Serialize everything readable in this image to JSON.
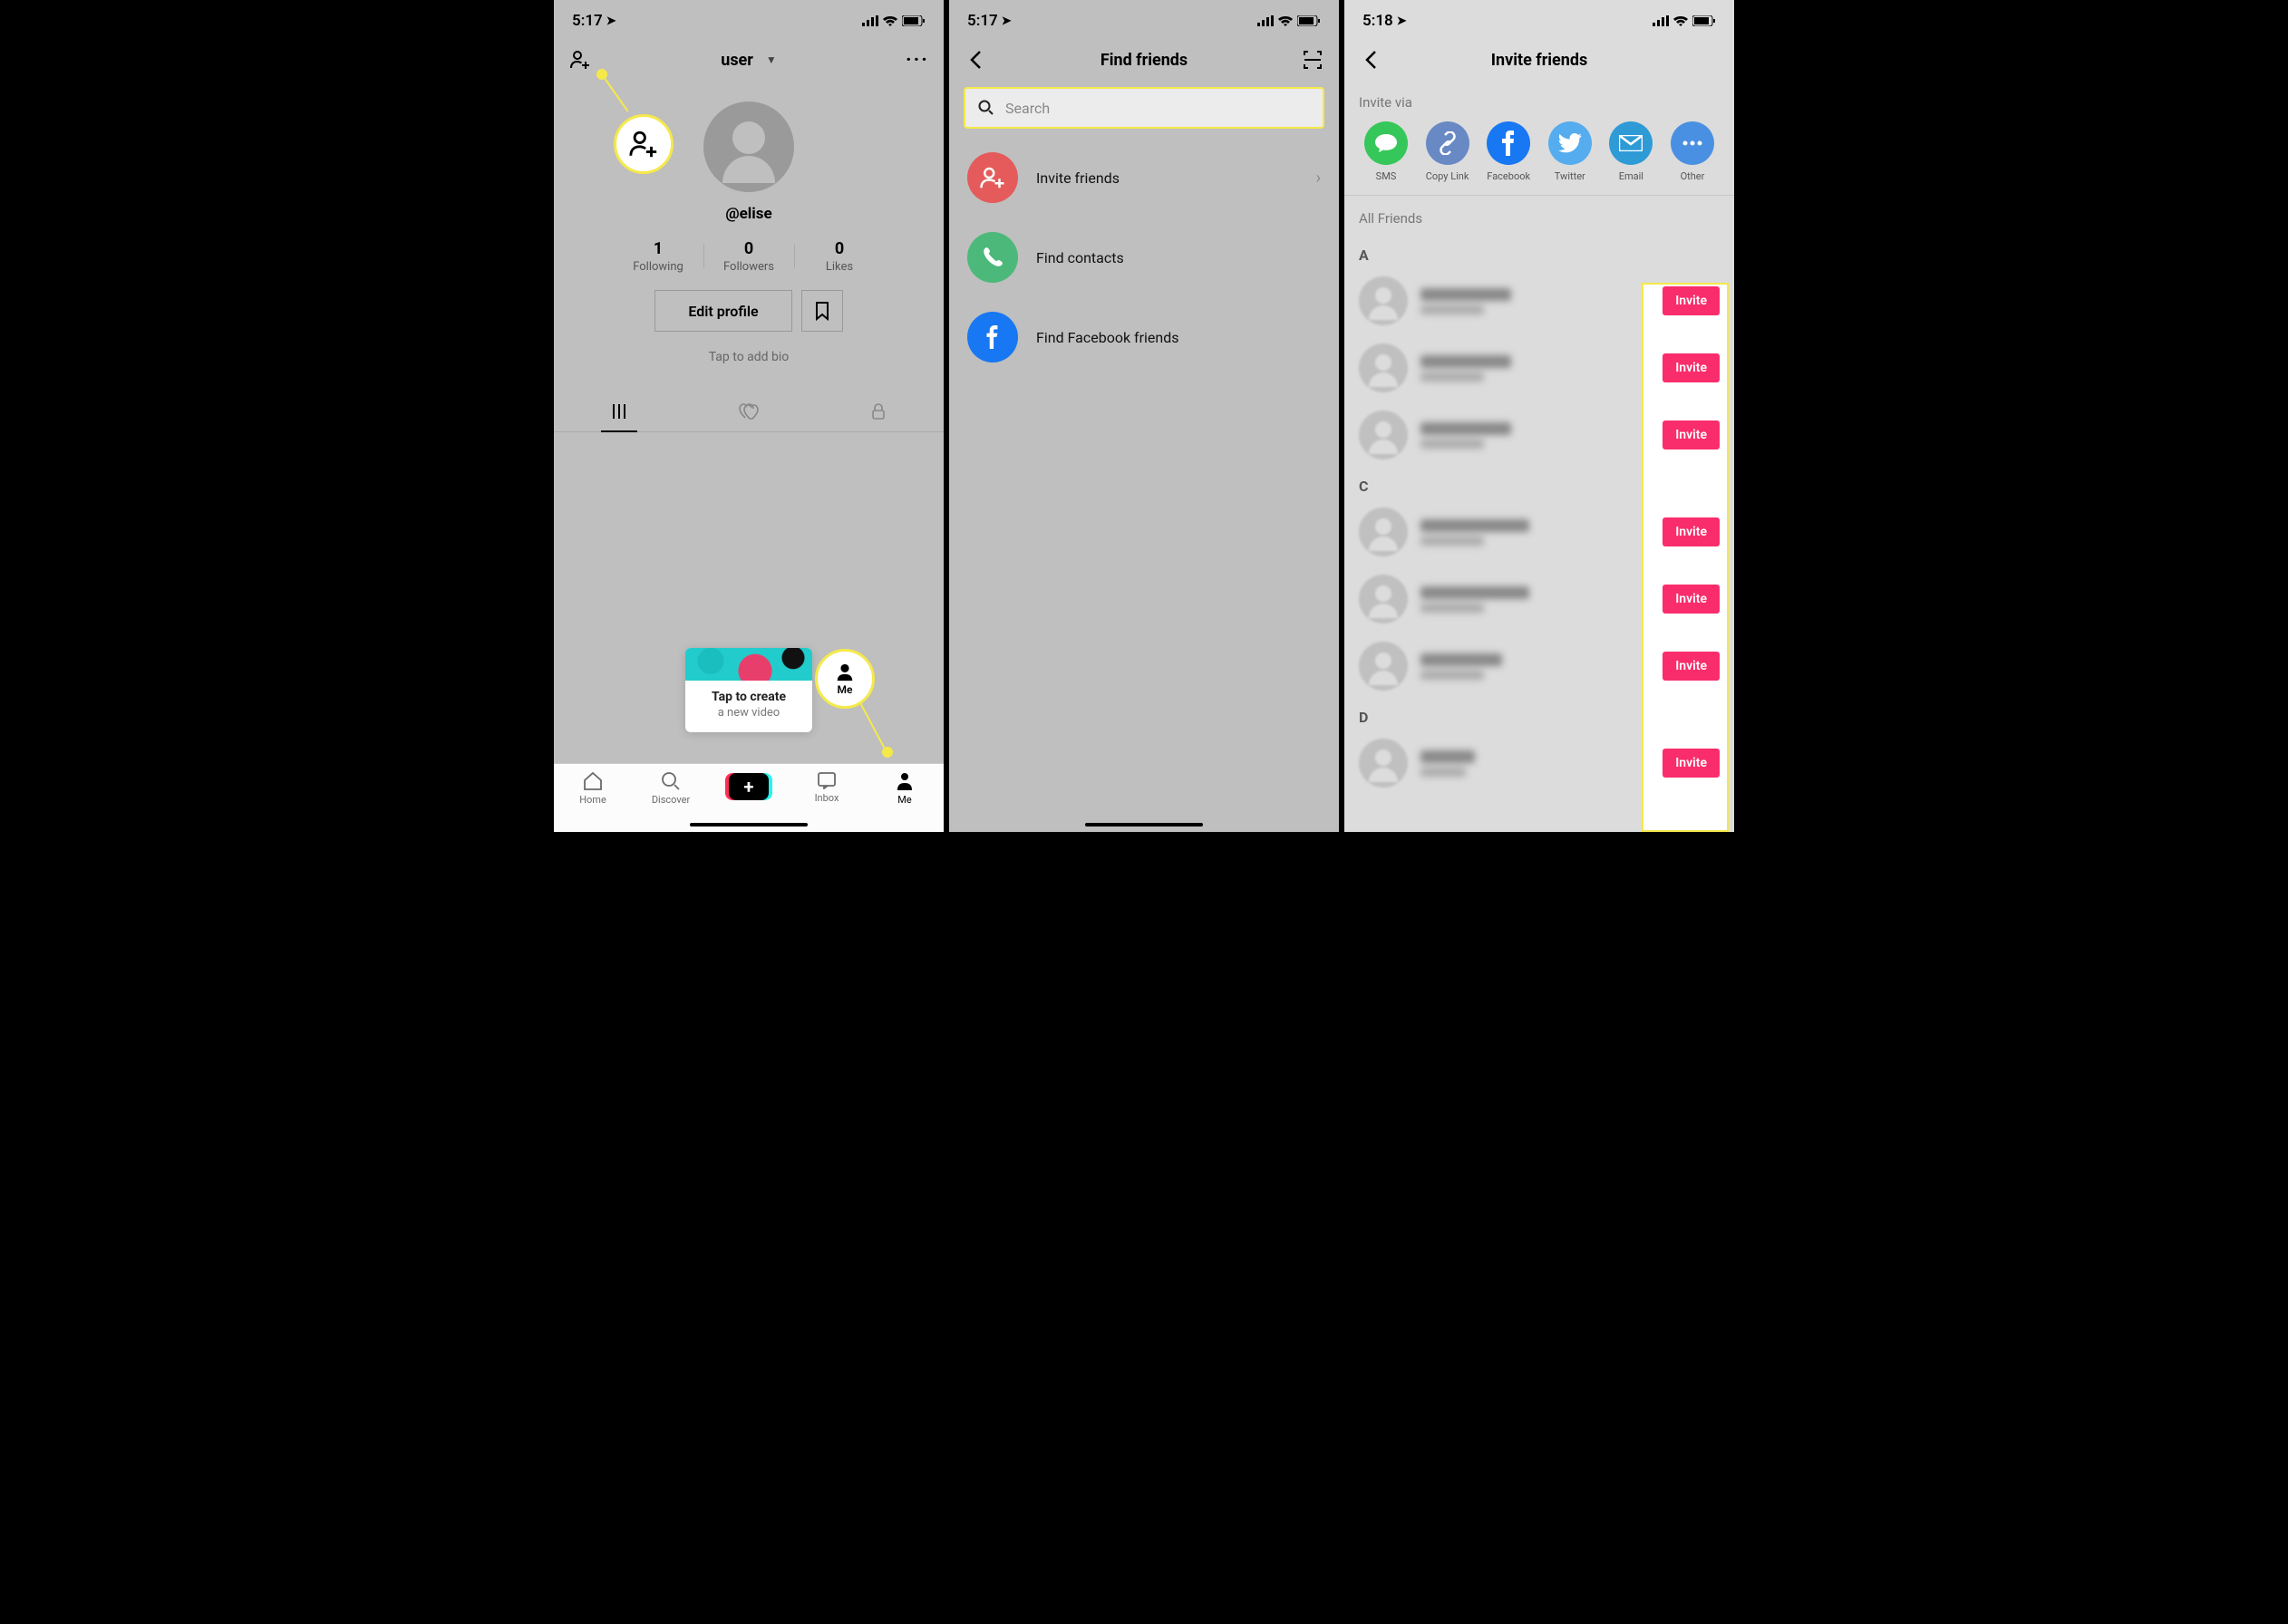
{
  "screen1": {
    "status_time": "5:17",
    "nav_title": "user",
    "username": "@elise",
    "stats": {
      "following_num": "1",
      "following_lbl": "Following",
      "followers_num": "0",
      "followers_lbl": "Followers",
      "likes_num": "0",
      "likes_lbl": "Likes"
    },
    "edit_profile": "Edit profile",
    "bio_hint": "Tap to add bio",
    "create_card_title": "Tap to create",
    "create_card_sub": "a new video",
    "callout_me_label": "Me",
    "tabs": {
      "home": "Home",
      "discover": "Discover",
      "inbox": "Inbox",
      "me": "Me"
    }
  },
  "screen2": {
    "status_time": "5:17",
    "title": "Find friends",
    "search_placeholder": "Search",
    "row_invite": "Invite friends",
    "row_contacts": "Find contacts",
    "row_facebook": "Find Facebook friends"
  },
  "screen3": {
    "status_time": "5:18",
    "title": "Invite friends",
    "invite_via_lbl": "Invite via",
    "share": {
      "sms": "SMS",
      "copy": "Copy Link",
      "facebook": "Facebook",
      "twitter": "Twitter",
      "email": "Email",
      "other": "Other"
    },
    "all_friends_lbl": "All Friends",
    "letter_a": "A",
    "letter_c": "C",
    "letter_d": "D",
    "invite_btn": "Invite"
  }
}
